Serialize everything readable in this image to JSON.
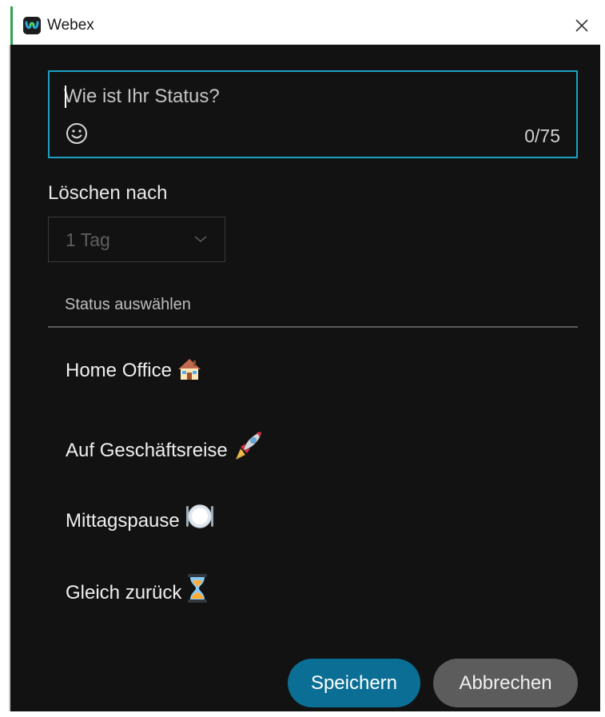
{
  "window": {
    "title": "Webex"
  },
  "status_input": {
    "placeholder": "Wie ist Ihr Status?",
    "value": "",
    "char_count": "0/75",
    "emoji_picker_icon": "smiley-icon"
  },
  "clear_after": {
    "label": "Löschen nach",
    "selected": "1 Tag"
  },
  "preset_statuses": {
    "header": "Status auswählen",
    "items": [
      {
        "label": "Home Office",
        "icon": "house-icon"
      },
      {
        "label": "Auf Geschäftsreise",
        "icon": "rocket-icon"
      },
      {
        "label": "Mittagspause",
        "icon": "plate-icon"
      },
      {
        "label": "Gleich zurück",
        "icon": "hourglass-icon"
      }
    ]
  },
  "buttons": {
    "save": "Speichern",
    "cancel": "Abbrechen"
  },
  "colors": {
    "background": "#121212",
    "focus_border": "#1aa1c2",
    "primary_button": "#0b6f95",
    "secondary_button": "#5c5c5c"
  }
}
